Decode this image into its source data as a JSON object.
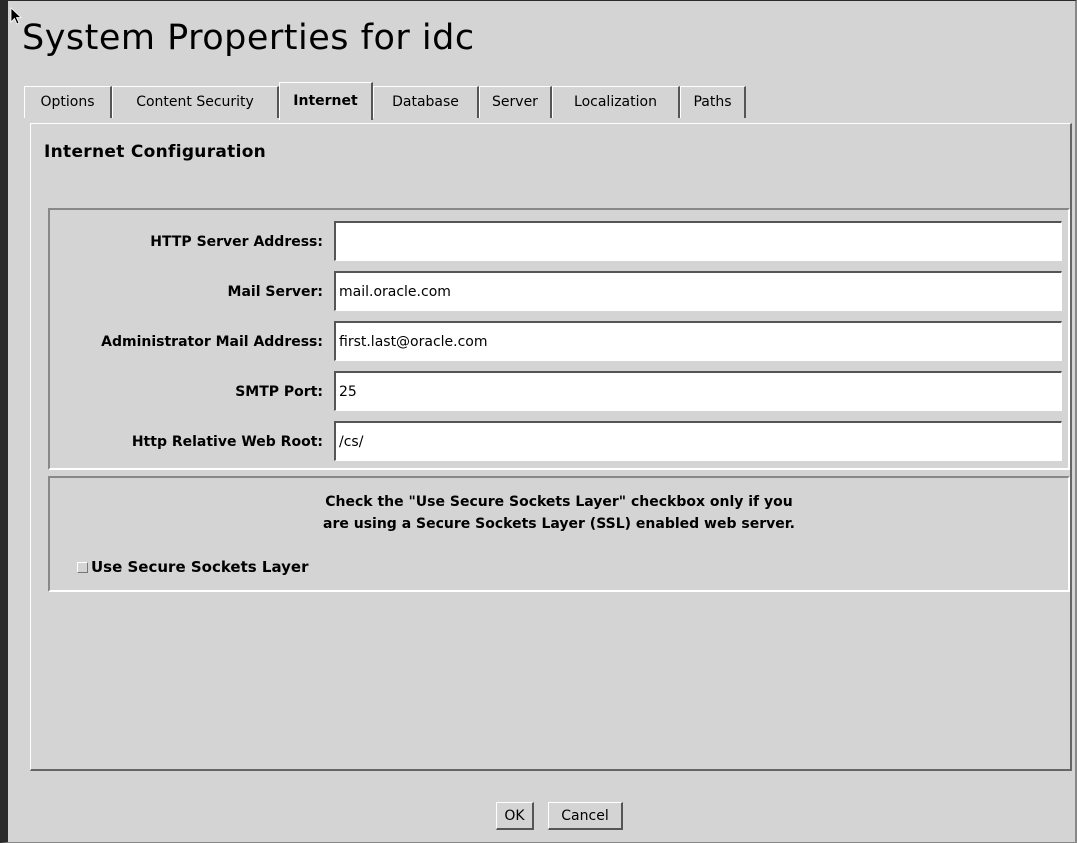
{
  "window": {
    "title": "System Properties for idc"
  },
  "tabs": [
    {
      "label": "Options"
    },
    {
      "label": "Content Security"
    },
    {
      "label": "Internet",
      "active": true
    },
    {
      "label": "Database"
    },
    {
      "label": "Server"
    },
    {
      "label": "Localization"
    },
    {
      "label": "Paths"
    }
  ],
  "panel": {
    "title": "Internet Configuration",
    "fields": [
      {
        "label": "HTTP Server Address:",
        "value": ""
      },
      {
        "label": "Mail Server:",
        "value": "mail.oracle.com"
      },
      {
        "label": "Administrator Mail Address:",
        "value": "first.last@oracle.com"
      },
      {
        "label": "SMTP Port:",
        "value": "25"
      },
      {
        "label": "Http Relative Web Root:",
        "value": "/cs/"
      }
    ],
    "ssl": {
      "notice_line1": "Check the \"Use Secure Sockets Layer\" checkbox only if you",
      "notice_line2": "are using a Secure Sockets Layer (SSL) enabled web server.",
      "checkbox_label": "Use Secure Sockets Layer",
      "checked": false
    }
  },
  "buttons": {
    "ok": "OK",
    "cancel": "Cancel"
  }
}
